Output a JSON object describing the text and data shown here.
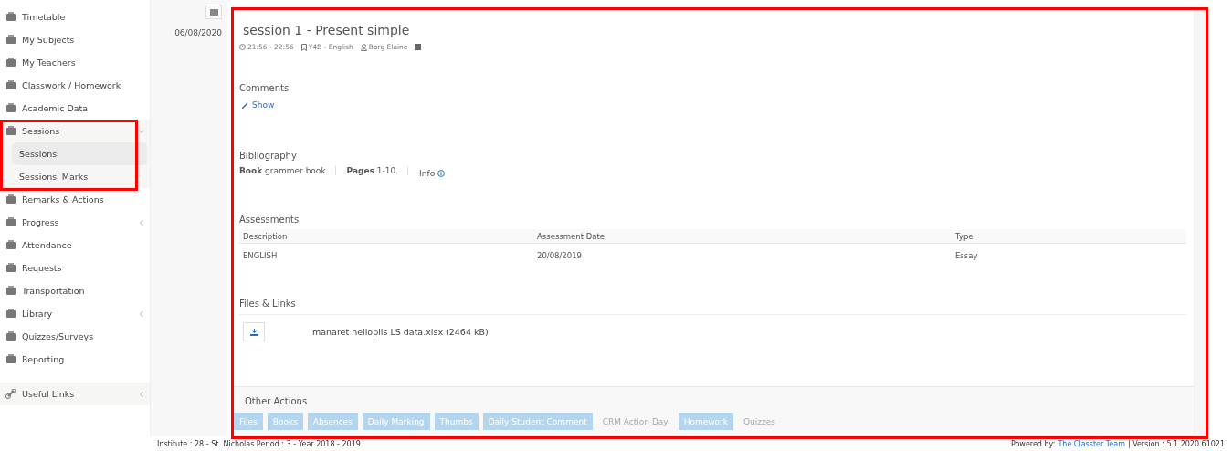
{
  "sidebar": {
    "items": [
      {
        "label": "Timetable",
        "kind": "link"
      },
      {
        "label": "My Subjects",
        "kind": "link"
      },
      {
        "label": "My Teachers",
        "kind": "link"
      },
      {
        "label": "Classwork / Homework",
        "kind": "link"
      },
      {
        "label": "Academic Data",
        "kind": "link"
      },
      {
        "label": "Sessions",
        "kind": "group",
        "expanded": true,
        "children": [
          {
            "label": "Sessions",
            "selected": true
          },
          {
            "label": "Sessions' Marks",
            "selected": false
          }
        ]
      },
      {
        "label": "Remarks & Actions",
        "kind": "link"
      },
      {
        "label": "Progress",
        "kind": "group",
        "expanded": false
      },
      {
        "label": "Attendance",
        "kind": "link"
      },
      {
        "label": "Requests",
        "kind": "link"
      },
      {
        "label": "Transportation",
        "kind": "link"
      },
      {
        "label": "Library",
        "kind": "group",
        "expanded": false
      },
      {
        "label": "Quizzes/Surveys",
        "kind": "link"
      },
      {
        "label": "Reporting",
        "kind": "link"
      }
    ],
    "footer_item": {
      "label": "Useful Links"
    }
  },
  "date": "06/08/2020",
  "session": {
    "title": "session 1 - Present simple",
    "time": "21:56 - 22:56",
    "class": "Y4B - English",
    "teacher": "Borg Elaine",
    "comments": {
      "heading": "Comments",
      "link": "Show"
    },
    "bibliography": {
      "heading": "Bibliography",
      "book_label": "Book",
      "book": "grammer book",
      "pages_label": "Pages",
      "pages": "1-10.",
      "info": "Info"
    },
    "assessments": {
      "heading": "Assessments",
      "columns": [
        "Description",
        "Assessment Date",
        "Type"
      ],
      "rows": [
        [
          "ENGLISH",
          "20/08/2019",
          "Essay"
        ]
      ]
    },
    "files": {
      "heading": "Files & Links",
      "items": [
        {
          "name": "manaret helioplis LS data.xlsx (2464 kB)"
        }
      ]
    },
    "other_actions": {
      "heading": "Other Actions",
      "buttons": [
        {
          "label": "Files",
          "disabled": false
        },
        {
          "label": "Books",
          "disabled": false
        },
        {
          "label": "Absences",
          "disabled": false
        },
        {
          "label": "Daily Marking",
          "disabled": false
        },
        {
          "label": "Thumbs",
          "disabled": false
        },
        {
          "label": "Daily Student Comment",
          "disabled": false
        },
        {
          "label": "CRM Action Day",
          "disabled": true
        },
        {
          "label": "Homework",
          "disabled": false
        },
        {
          "label": "Quizzes",
          "disabled": true
        }
      ]
    }
  },
  "status_bar": {
    "institute": "Institute : 28 - St. Nicholas Period : 3 - Year 2018 - 2019",
    "powered": "Powered by:",
    "team": "The Classter Team",
    "version": "| Version : 5.1.2020.61021"
  }
}
